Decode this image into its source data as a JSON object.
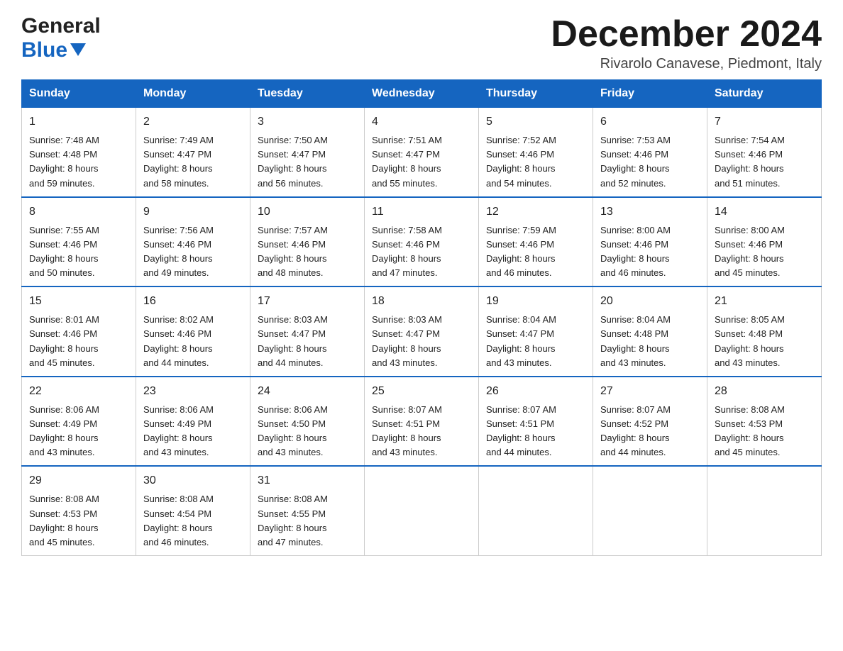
{
  "logo": {
    "general": "General",
    "blue": "Blue"
  },
  "title": "December 2024",
  "location": "Rivarolo Canavese, Piedmont, Italy",
  "days_of_week": [
    "Sunday",
    "Monday",
    "Tuesday",
    "Wednesday",
    "Thursday",
    "Friday",
    "Saturday"
  ],
  "weeks": [
    [
      {
        "day": "1",
        "sunrise": "7:48 AM",
        "sunset": "4:48 PM",
        "daylight": "8 hours and 59 minutes."
      },
      {
        "day": "2",
        "sunrise": "7:49 AM",
        "sunset": "4:47 PM",
        "daylight": "8 hours and 58 minutes."
      },
      {
        "day": "3",
        "sunrise": "7:50 AM",
        "sunset": "4:47 PM",
        "daylight": "8 hours and 56 minutes."
      },
      {
        "day": "4",
        "sunrise": "7:51 AM",
        "sunset": "4:47 PM",
        "daylight": "8 hours and 55 minutes."
      },
      {
        "day": "5",
        "sunrise": "7:52 AM",
        "sunset": "4:46 PM",
        "daylight": "8 hours and 54 minutes."
      },
      {
        "day": "6",
        "sunrise": "7:53 AM",
        "sunset": "4:46 PM",
        "daylight": "8 hours and 52 minutes."
      },
      {
        "day": "7",
        "sunrise": "7:54 AM",
        "sunset": "4:46 PM",
        "daylight": "8 hours and 51 minutes."
      }
    ],
    [
      {
        "day": "8",
        "sunrise": "7:55 AM",
        "sunset": "4:46 PM",
        "daylight": "8 hours and 50 minutes."
      },
      {
        "day": "9",
        "sunrise": "7:56 AM",
        "sunset": "4:46 PM",
        "daylight": "8 hours and 49 minutes."
      },
      {
        "day": "10",
        "sunrise": "7:57 AM",
        "sunset": "4:46 PM",
        "daylight": "8 hours and 48 minutes."
      },
      {
        "day": "11",
        "sunrise": "7:58 AM",
        "sunset": "4:46 PM",
        "daylight": "8 hours and 47 minutes."
      },
      {
        "day": "12",
        "sunrise": "7:59 AM",
        "sunset": "4:46 PM",
        "daylight": "8 hours and 46 minutes."
      },
      {
        "day": "13",
        "sunrise": "8:00 AM",
        "sunset": "4:46 PM",
        "daylight": "8 hours and 46 minutes."
      },
      {
        "day": "14",
        "sunrise": "8:00 AM",
        "sunset": "4:46 PM",
        "daylight": "8 hours and 45 minutes."
      }
    ],
    [
      {
        "day": "15",
        "sunrise": "8:01 AM",
        "sunset": "4:46 PM",
        "daylight": "8 hours and 45 minutes."
      },
      {
        "day": "16",
        "sunrise": "8:02 AM",
        "sunset": "4:46 PM",
        "daylight": "8 hours and 44 minutes."
      },
      {
        "day": "17",
        "sunrise": "8:03 AM",
        "sunset": "4:47 PM",
        "daylight": "8 hours and 44 minutes."
      },
      {
        "day": "18",
        "sunrise": "8:03 AM",
        "sunset": "4:47 PM",
        "daylight": "8 hours and 43 minutes."
      },
      {
        "day": "19",
        "sunrise": "8:04 AM",
        "sunset": "4:47 PM",
        "daylight": "8 hours and 43 minutes."
      },
      {
        "day": "20",
        "sunrise": "8:04 AM",
        "sunset": "4:48 PM",
        "daylight": "8 hours and 43 minutes."
      },
      {
        "day": "21",
        "sunrise": "8:05 AM",
        "sunset": "4:48 PM",
        "daylight": "8 hours and 43 minutes."
      }
    ],
    [
      {
        "day": "22",
        "sunrise": "8:06 AM",
        "sunset": "4:49 PM",
        "daylight": "8 hours and 43 minutes."
      },
      {
        "day": "23",
        "sunrise": "8:06 AM",
        "sunset": "4:49 PM",
        "daylight": "8 hours and 43 minutes."
      },
      {
        "day": "24",
        "sunrise": "8:06 AM",
        "sunset": "4:50 PM",
        "daylight": "8 hours and 43 minutes."
      },
      {
        "day": "25",
        "sunrise": "8:07 AM",
        "sunset": "4:51 PM",
        "daylight": "8 hours and 43 minutes."
      },
      {
        "day": "26",
        "sunrise": "8:07 AM",
        "sunset": "4:51 PM",
        "daylight": "8 hours and 44 minutes."
      },
      {
        "day": "27",
        "sunrise": "8:07 AM",
        "sunset": "4:52 PM",
        "daylight": "8 hours and 44 minutes."
      },
      {
        "day": "28",
        "sunrise": "8:08 AM",
        "sunset": "4:53 PM",
        "daylight": "8 hours and 45 minutes."
      }
    ],
    [
      {
        "day": "29",
        "sunrise": "8:08 AM",
        "sunset": "4:53 PM",
        "daylight": "8 hours and 45 minutes."
      },
      {
        "day": "30",
        "sunrise": "8:08 AM",
        "sunset": "4:54 PM",
        "daylight": "8 hours and 46 minutes."
      },
      {
        "day": "31",
        "sunrise": "8:08 AM",
        "sunset": "4:55 PM",
        "daylight": "8 hours and 47 minutes."
      },
      null,
      null,
      null,
      null
    ]
  ],
  "labels": {
    "sunrise": "Sunrise:",
    "sunset": "Sunset:",
    "daylight": "Daylight:"
  }
}
